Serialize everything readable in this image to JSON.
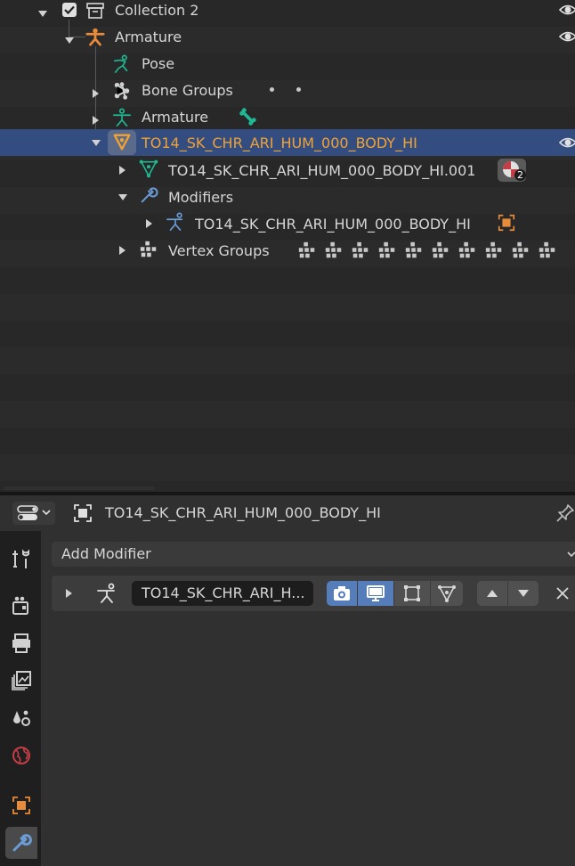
{
  "outliner": {
    "rows": [
      {
        "label": "Collection 2"
      },
      {
        "label": "Armature"
      },
      {
        "label": "Pose"
      },
      {
        "label": "Bone Groups"
      },
      {
        "label": "Armature"
      },
      {
        "label": "TO14_SK_CHR_ARI_HUM_000_BODY_HI"
      },
      {
        "label": "TO14_SK_CHR_ARI_HUM_000_BODY_HI.001",
        "badge": "2"
      },
      {
        "label": "Modifiers"
      },
      {
        "label": "TO14_SK_CHR_ARI_HUM_000_BODY_HI"
      },
      {
        "label": "Vertex Groups"
      }
    ]
  },
  "properties": {
    "object_name": "TO14_SK_CHR_ARI_HUM_000_BODY_HI",
    "add_modifier_label": "Add Modifier",
    "modifier": {
      "name": "TO14_SK_CHR_ARI_H...",
      "toggles": [
        "camera",
        "realtime",
        "editmode",
        "cage"
      ],
      "active_toggles": [
        "camera",
        "realtime"
      ]
    }
  },
  "colors": {
    "selected_row": "#334d80",
    "selected_text": "#f0a236",
    "armature_orange": "#e88b3a",
    "bone_green": "#20b893",
    "mesh_blue": "#6b9cd6",
    "toggle_on": "#547dba"
  },
  "icons": {
    "collection": "collection-box-icon",
    "armature": "armature-icon",
    "pose": "pose-icon",
    "bone_groups": "bone-groups-icon",
    "mesh": "mesh-object-icon",
    "modifier": "wrench-icon",
    "vertex_groups": "vertex-groups-icon",
    "visibility": "eye-icon"
  }
}
